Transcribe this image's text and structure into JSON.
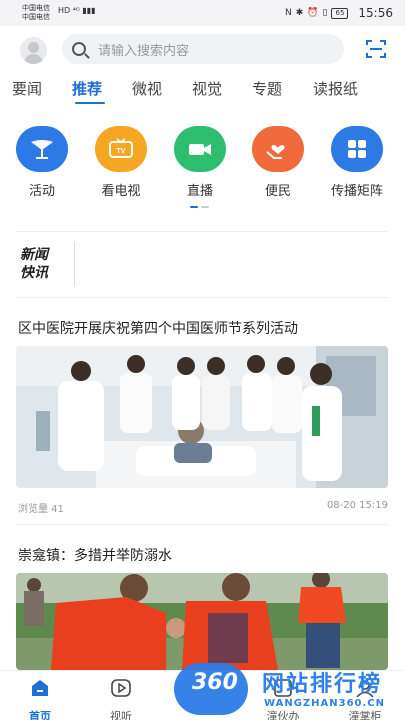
{
  "status_bar": {
    "carrier1": "中国电信",
    "carrier2": "中国电信",
    "signal1": "HD ⁴ᴳ ▮▮▮",
    "signal2": "HD ▮▮▮",
    "battery": "65",
    "time": "15:56"
  },
  "search": {
    "placeholder": "请输入搜索内容"
  },
  "tabs": [
    "要闻",
    "推荐",
    "微视",
    "视觉",
    "专题",
    "读报纸"
  ],
  "active_tab": "推荐",
  "quick_icons": [
    {
      "label": "活动",
      "color": "#2d79e6",
      "icon": "activity-icon"
    },
    {
      "label": "看电视",
      "color": "#f5a623",
      "icon": "tv-icon"
    },
    {
      "label": "直播",
      "color": "#2dbd6e",
      "icon": "live-camera-icon"
    },
    {
      "label": "便民",
      "color": "#f06a3c",
      "icon": "helping-hands-icon"
    },
    {
      "label": "传播矩阵",
      "color": "#2d79e6",
      "icon": "grid-icon"
    }
  ],
  "kuaixun": {
    "line1": "新闻",
    "line2": "快讯"
  },
  "articles": [
    {
      "title": "区中医院开展庆祝第四个中国医师节系列活动",
      "views": "浏览量 41",
      "date": "08-20 15:19"
    },
    {
      "title": "崇龛镇：多措并举防溺水"
    }
  ],
  "bottom_nav": [
    {
      "label": "首页",
      "icon": "home-icon",
      "active": true
    },
    {
      "label": "视听",
      "icon": "play-icon",
      "active": false
    },
    {
      "label": "",
      "icon": "center-icon",
      "active": false
    },
    {
      "label": "潼伙办",
      "icon": "service-icon",
      "active": false
    },
    {
      "label": "潼掌柜",
      "icon": "user-icon",
      "active": false
    }
  ],
  "watermark": {
    "num": "360",
    "text": "网站排行榜",
    "sub": "WANGZHAN360.CN"
  }
}
